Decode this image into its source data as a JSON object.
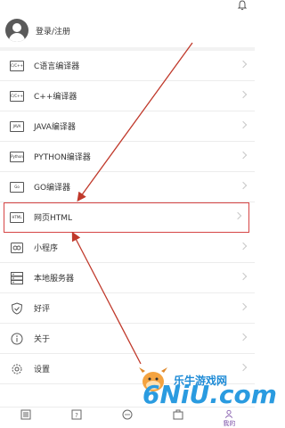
{
  "user": {
    "login_label": "登录/注册"
  },
  "menu": {
    "items": [
      {
        "label": "C语言编译器",
        "icon": "c-code-icon",
        "icon_text": "C/C++"
      },
      {
        "label": "C++编译器",
        "icon": "cpp-code-icon",
        "icon_text": "C/C++"
      },
      {
        "label": "JAVA编译器",
        "icon": "java-code-icon",
        "icon_text": "JAVA"
      },
      {
        "label": "PYTHON编译器",
        "icon": "python-code-icon",
        "icon_text": "Python"
      },
      {
        "label": "GO编译器",
        "icon": "go-code-icon",
        "icon_text": "Go"
      },
      {
        "label": "网页HTML",
        "icon": "html-code-icon",
        "icon_text": "HTML"
      },
      {
        "label": "小程序",
        "icon": "link-icon"
      },
      {
        "label": "本地服务器",
        "icon": "server-icon"
      },
      {
        "label": "好评",
        "icon": "shield-heart-icon"
      },
      {
        "label": "关于",
        "icon": "info-icon"
      },
      {
        "label": "设置",
        "icon": "gear-icon"
      }
    ]
  },
  "bottom_nav": {
    "items": [
      {
        "label": "",
        "icon": "list-icon"
      },
      {
        "label": "",
        "icon": "help-icon"
      },
      {
        "label": "",
        "icon": "chat-icon"
      },
      {
        "label": "",
        "icon": "briefcase-icon"
      },
      {
        "label": "我的",
        "icon": "person-icon",
        "active": true
      }
    ]
  },
  "watermark": {
    "text": "乐牛游戏网",
    "logo": "6NiU.com"
  },
  "colors": {
    "highlight": "#d64545",
    "arrow": "#c0392b",
    "active": "#7a4ea6"
  }
}
